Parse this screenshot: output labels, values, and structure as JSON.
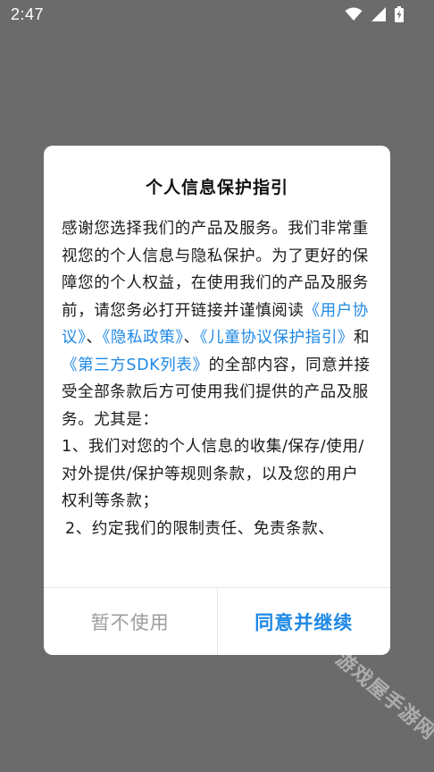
{
  "status_bar": {
    "time": "2:47",
    "icons": [
      "wifi-icon",
      "signal-icon",
      "battery-icon"
    ]
  },
  "dialog": {
    "title": "个人信息保护指引",
    "body": {
      "intro_1": "感谢您选择我们的产品及服务。我们非常重视您的个人信息与隐私保护。为了更好的保障您的个人权益，在使用我们的产品及服务前，请您务必打开链接并谨慎阅读",
      "link_user_agreement": "《用户协议》",
      "sep_1": "、",
      "link_privacy_policy": "《隐私政策》",
      "sep_2": "、",
      "link_children_guide": "《儿童协议保护指引》",
      "sep_3": "和",
      "link_sdk_list": "《第三方SDK列表》",
      "intro_2": "的全部内容，同意并接受全部条款后方可使用我们提供的产品及服务。尤其是：",
      "item_1": "1、我们对您的个人信息的收集/保存/使用/对外提供/保护等规则条款，以及您的用户权利等条款；",
      "item_2": "2、约定我们的限制责任、免责条款、"
    },
    "buttons": {
      "decline": "暂不使用",
      "accept": "同意并继续"
    }
  },
  "watermark": "游戏屋手游网",
  "colors": {
    "overlay": "#6b6b6b",
    "link": "#1e88e5",
    "decline_text": "#9e9e9e"
  }
}
